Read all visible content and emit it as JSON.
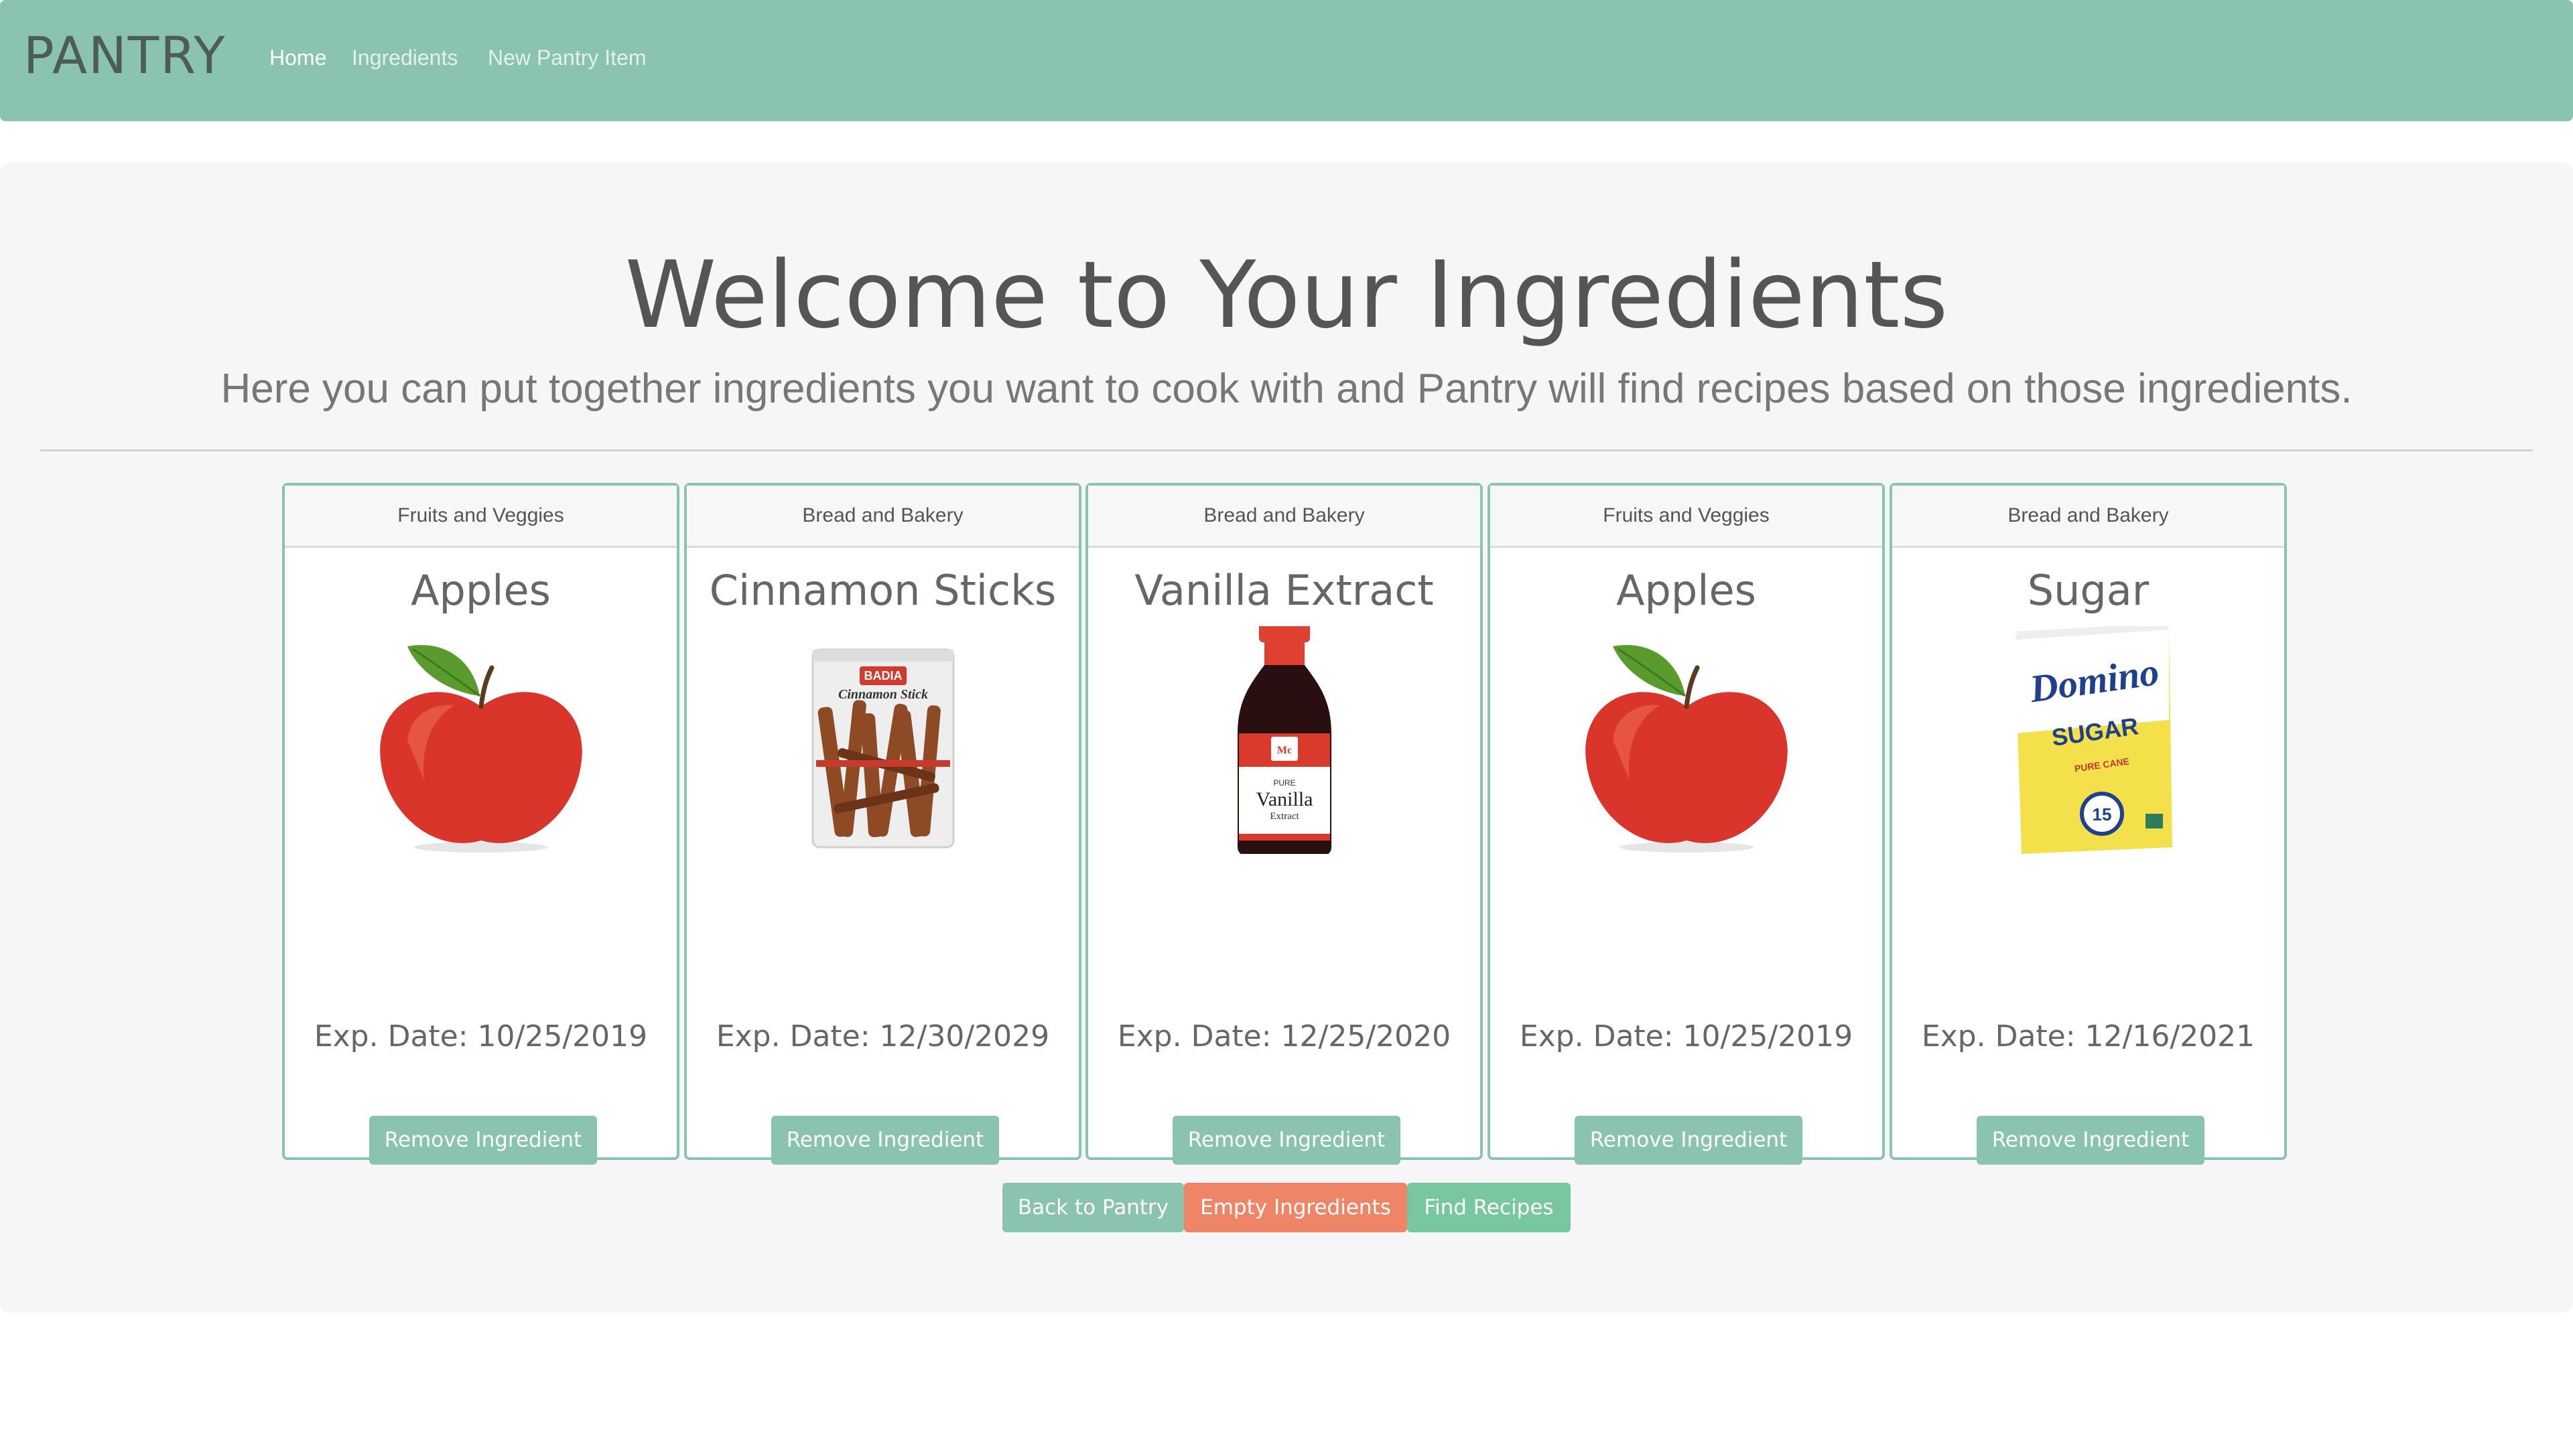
{
  "app": {
    "brand": "PANTRY"
  },
  "nav": {
    "home": "Home",
    "ingredients": "Ingredients",
    "new_item": "New Pantry Item"
  },
  "hero": {
    "title": "Welcome to Your Ingredients",
    "subtitle": "Here you can put together ingredients you want to cook with and Pantry will find recipes based on those ingredients."
  },
  "cards": [
    {
      "category": "Fruits and Veggies",
      "name": "Apples",
      "exp": "Exp. Date: 10/25/2019",
      "button": "Remove Ingredient",
      "image": "apple"
    },
    {
      "category": "Bread and Bakery",
      "name": "Cinnamon Sticks",
      "exp": "Exp. Date: 12/30/2029",
      "button": "Remove Ingredient",
      "image": "cinnamon-bag"
    },
    {
      "category": "Bread and Bakery",
      "name": "Vanilla Extract",
      "exp": "Exp. Date: 12/25/2020",
      "button": "Remove Ingredient",
      "image": "vanilla-bottle"
    },
    {
      "category": "Fruits and Veggies",
      "name": "Apples",
      "exp": "Exp. Date: 10/25/2019",
      "button": "Remove Ingredient",
      "image": "apple"
    },
    {
      "category": "Bread and Bakery",
      "name": "Sugar",
      "exp": "Exp. Date: 12/16/2021",
      "button": "Remove Ingredient",
      "image": "sugar-bag"
    }
  ],
  "actions": {
    "back": "Back to Pantry",
    "empty": "Empty Ingredients",
    "find": "Find Recipes"
  },
  "product_labels": {
    "cinnamon_brand": "BADIA",
    "cinnamon_label": "Cinnamon Stick",
    "vanilla_brand": "McCormick",
    "vanilla_pure": "PURE",
    "vanilla_name": "Vanilla",
    "vanilla_extract": "Extract",
    "sugar_brand": "Domino",
    "sugar_type": "SUGAR",
    "sugar_desc": "PURE CANE",
    "sugar_cal": "15"
  },
  "colors": {
    "navbar": "#8ac3ae",
    "card_border": "#8ac3ae",
    "remove_button": "#8ac3ae",
    "back_button": "#8ac3ae",
    "empty_button": "#ee8566",
    "find_button": "#79c79f",
    "jumbotron": "#f6f6f8"
  }
}
